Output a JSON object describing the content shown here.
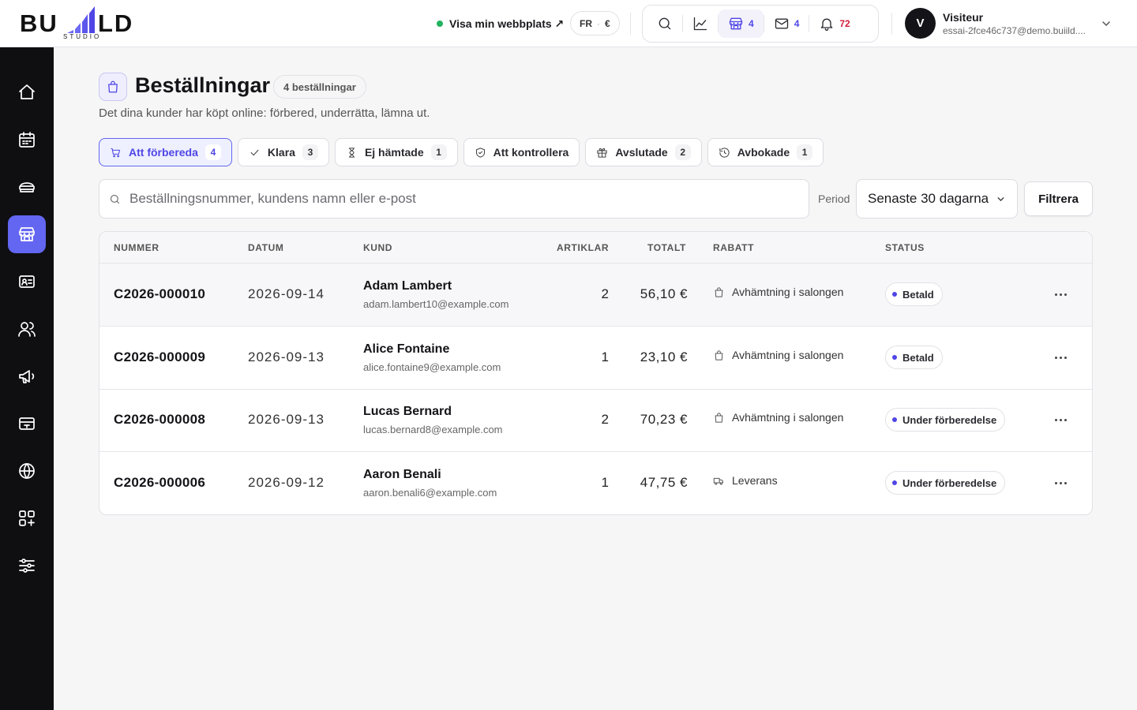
{
  "brand": {
    "logo_left": "BU",
    "logo_right": "LD",
    "logo_sub": "STUDIO"
  },
  "topbar": {
    "site_link": "Visa min webbplats ↗",
    "lang": "FR",
    "currency": "€",
    "icons": [
      {
        "name": "search-icon",
        "count": ""
      },
      {
        "name": "chart-icon",
        "count": ""
      },
      {
        "name": "store-icon",
        "count": "4"
      },
      {
        "name": "mail-icon",
        "count": "4"
      },
      {
        "name": "bell-icon",
        "count": "72"
      }
    ],
    "user": {
      "initial": "V",
      "name": "Visiteur",
      "email": "essai-2fce46c737@demo.buiild...."
    }
  },
  "sidebar": {
    "items": [
      "home-icon",
      "calendar-icon",
      "services-icon",
      "shop-icon",
      "contact-card-icon",
      "customers-icon",
      "megaphone-icon",
      "payment-icon",
      "globe-icon",
      "apps-icon",
      "settings-icon"
    ],
    "active": "shop-icon"
  },
  "page": {
    "title": "Beställningar",
    "count_badge": "4 beställningar",
    "subtitle": "Det dina kunder har köpt online: förbered, underrätta, lämna ut."
  },
  "tabs": [
    {
      "label": "Att förbereda",
      "count": "4",
      "icon": "cart-icon",
      "active": true
    },
    {
      "label": "Klara",
      "count": "3",
      "icon": "check-icon",
      "active": false
    },
    {
      "label": "Ej hämtade",
      "count": "1",
      "icon": "hourglass-icon",
      "active": false
    },
    {
      "label": "Att kontrollera",
      "count": "",
      "icon": "shield-icon",
      "active": false
    },
    {
      "label": "Avslutade",
      "count": "2",
      "icon": "gift-icon",
      "active": false
    },
    {
      "label": "Avbokade",
      "count": "1",
      "icon": "history-icon",
      "active": false
    }
  ],
  "filters": {
    "search_placeholder": "Beställningsnummer, kundens namn eller e-post",
    "period_label": "Period",
    "period_value": "Senaste 30 dagarna",
    "filter_button": "Filtrera"
  },
  "table": {
    "headers": [
      "NUMMER",
      "DATUM",
      "KUND",
      "ARTIKLAR",
      "TOTALT",
      "RABATT",
      "STATUS"
    ],
    "rows": [
      {
        "number": "C2026-000010",
        "date": "2026-09-14",
        "customer": "Adam Lambert",
        "email": "adam.lambert10@example.com",
        "items": "2",
        "total": "56,10 €",
        "delivery": "Avhämtning i salongen",
        "delivery_icon": "bag-icon",
        "status": "Betald"
      },
      {
        "number": "C2026-000009",
        "date": "2026-09-13",
        "customer": "Alice Fontaine",
        "email": "alice.fontaine9@example.com",
        "items": "1",
        "total": "23,10 €",
        "delivery": "Avhämtning i salongen",
        "delivery_icon": "bag-icon",
        "status": "Betald"
      },
      {
        "number": "C2026-000008",
        "date": "2026-09-13",
        "customer": "Lucas Bernard",
        "email": "lucas.bernard8@example.com",
        "items": "2",
        "total": "70,23 €",
        "delivery": "Avhämtning i salongen",
        "delivery_icon": "bag-icon",
        "status": "Under förberedelse"
      },
      {
        "number": "C2026-000006",
        "date": "2026-09-12",
        "customer": "Aaron Benali",
        "email": "aaron.benali6@example.com",
        "items": "1",
        "total": "47,75 €",
        "delivery": "Leverans",
        "delivery_icon": "truck-icon",
        "status": "Under förberedelse"
      }
    ]
  },
  "colors": {
    "accent": "#4f46e5",
    "accent_sidebar": "#6366f1",
    "sidebar_bg": "#0f0f12",
    "online": "#22b35e",
    "alert": "#d11f3a"
  }
}
